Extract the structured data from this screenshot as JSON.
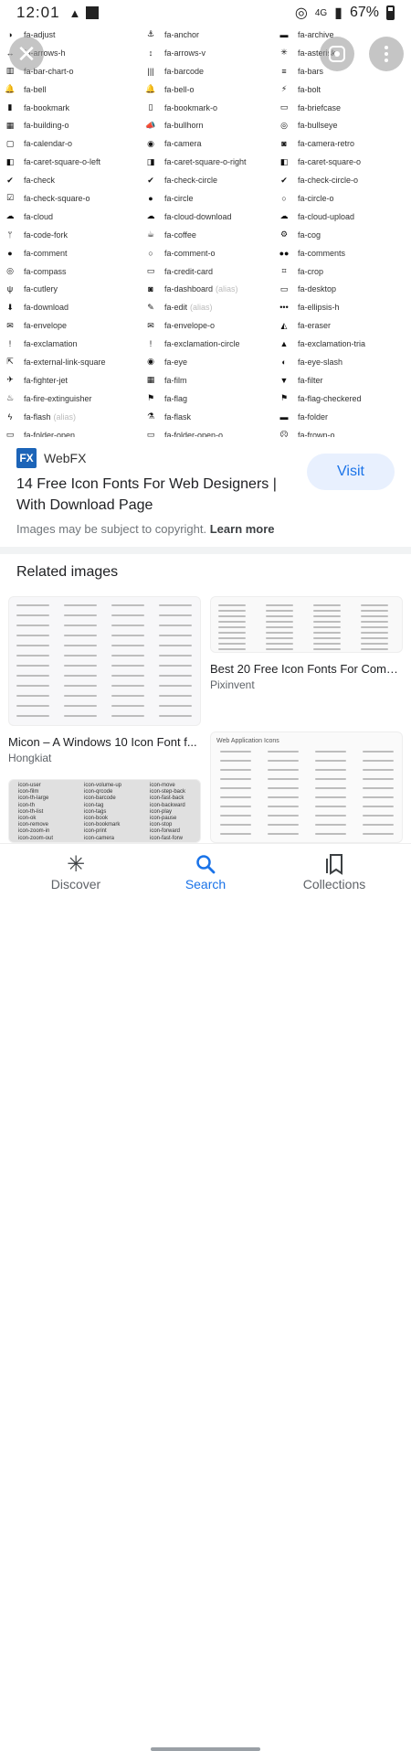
{
  "status_bar": {
    "time": "12:01",
    "network": "4G",
    "battery": "67%"
  },
  "preview_icons": [
    [
      "fa-adjust",
      "fa-anchor",
      "fa-archive"
    ],
    [
      "fa-arrows-h",
      "fa-arrows-v",
      "fa-asterisk"
    ],
    [
      "fa-bar-chart-o",
      "fa-barcode",
      "fa-bars"
    ],
    [
      "fa-bell",
      "fa-bell-o",
      "fa-bolt"
    ],
    [
      "fa-bookmark",
      "fa-bookmark-o",
      "fa-briefcase"
    ],
    [
      "fa-building-o",
      "fa-bullhorn",
      "fa-bullseye"
    ],
    [
      "fa-calendar-o",
      "fa-camera",
      "fa-camera-retro"
    ],
    [
      "fa-caret-square-o-left",
      "fa-caret-square-o-right",
      "fa-caret-square-o"
    ],
    [
      "fa-check",
      "fa-check-circle",
      "fa-check-circle-o"
    ],
    [
      "fa-check-square-o",
      "fa-circle",
      "fa-circle-o"
    ],
    [
      "fa-cloud",
      "fa-cloud-download",
      "fa-cloud-upload"
    ],
    [
      "fa-code-fork",
      "fa-coffee",
      "fa-cog"
    ],
    [
      "fa-comment",
      "fa-comment-o",
      "fa-comments"
    ],
    [
      "fa-compass",
      "fa-credit-card",
      "fa-crop"
    ],
    [
      "fa-cutlery",
      "fa-dashboard",
      "fa-desktop"
    ],
    [
      "fa-download",
      "fa-edit",
      "fa-ellipsis-h"
    ],
    [
      "fa-envelope",
      "fa-envelope-o",
      "fa-eraser"
    ],
    [
      "fa-exclamation",
      "fa-exclamation-circle",
      "fa-exclamation-tria"
    ],
    [
      "fa-external-link-square",
      "fa-eye",
      "fa-eye-slash"
    ],
    [
      "fa-fighter-jet",
      "fa-film",
      "fa-filter"
    ],
    [
      "fa-fire-extinguisher",
      "fa-flag",
      "fa-flag-checkered"
    ],
    [
      "fa-flash",
      "fa-flask",
      "fa-folder"
    ],
    [
      "fa-folder-open",
      "fa-folder-open-o",
      "fa-frown-o"
    ]
  ],
  "preview_aliases": {
    "dashboard": "(alias)",
    "edit": "(alias)",
    "flash": "(alias)"
  },
  "source": {
    "logo_text": "FX",
    "name": "WebFX"
  },
  "result_title": "14 Free Icon Fonts For Web Designers | With Download Page",
  "visit_label": "Visit",
  "copyright_text": "Images may be subject to copyright.",
  "learn_more": "Learn more",
  "related_heading": "Related images",
  "related": [
    {
      "title": "Micon – A Windows 10 Icon Font f...",
      "source": "Hongkiat"
    },
    {
      "title": "Best 20 Free Icon Fonts For Comm...",
      "source": "Pixinvent"
    }
  ],
  "thumb_texts": {
    "web_app_header": "Web Application Icons",
    "icon_list": [
      "icon-user",
      "icon-film",
      "icon-th-large",
      "icon-th",
      "icon-th-list",
      "icon-ok",
      "icon-remove",
      "icon-zoom-in",
      "icon-zoom-out"
    ],
    "icon_list2": [
      "icon-volume-up",
      "icon-qrcode",
      "icon-barcode",
      "icon-tag",
      "icon-tags",
      "icon-book",
      "icon-bookmark",
      "icon-print",
      "icon-camera"
    ],
    "icon_list3": [
      "icon-move",
      "icon-step-back",
      "icon-fast-back",
      "icon-backward",
      "icon-play",
      "icon-pause",
      "icon-stop",
      "icon-forward",
      "icon-fast-forw"
    ]
  },
  "nav": [
    {
      "label": "Discover",
      "icon": "asterisk-icon"
    },
    {
      "label": "Search",
      "icon": "search-icon"
    },
    {
      "label": "Collections",
      "icon": "bookmarks-icon"
    }
  ]
}
